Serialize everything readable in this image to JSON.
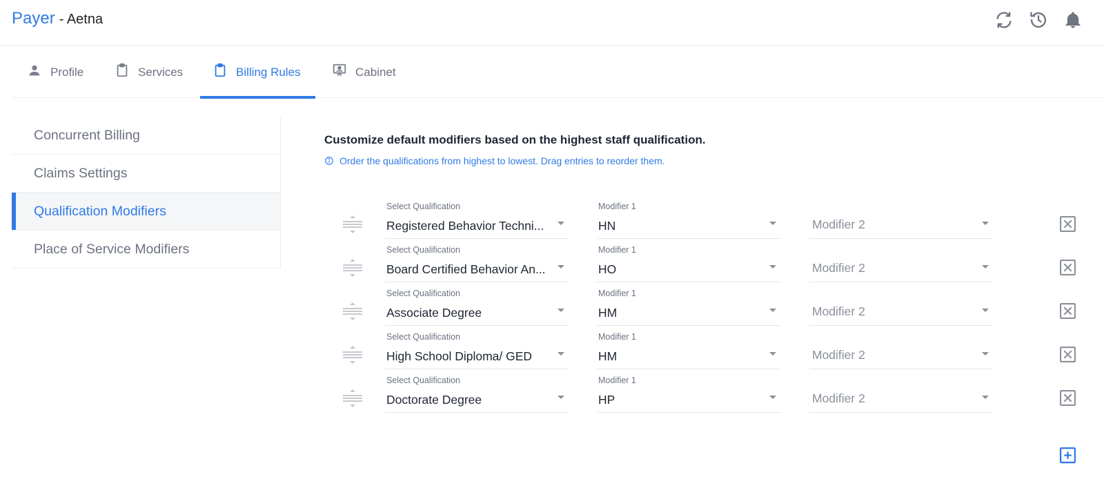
{
  "header": {
    "brand": "Payer",
    "subtitle": "- Aetna",
    "icons": [
      "sync-icon",
      "history-icon",
      "bell-icon"
    ]
  },
  "tabs": [
    {
      "label": "Profile",
      "icon": "person-icon",
      "active": false
    },
    {
      "label": "Services",
      "icon": "clipboard-icon",
      "active": false
    },
    {
      "label": "Billing Rules",
      "icon": "clipboard-icon",
      "active": true
    },
    {
      "label": "Cabinet",
      "icon": "presentation-icon",
      "active": false
    }
  ],
  "sidebar": {
    "items": [
      {
        "label": "Concurrent Billing",
        "active": false
      },
      {
        "label": "Claims Settings",
        "active": false
      },
      {
        "label": "Qualification Modifiers",
        "active": true
      },
      {
        "label": "Place of Service Modifiers",
        "active": false
      }
    ]
  },
  "main": {
    "title": "Customize default modifiers based on the highest staff qualification.",
    "note": "Order the qualifications from highest to lowest. Drag entries to reorder them.",
    "rows": [
      {
        "qual_label": "Select Qualification",
        "qualification": "Registered Behavior Techni...",
        "mod1_label": "Modifier 1",
        "modifier1": "HN",
        "modifier2_placeholder": "Modifier 2"
      },
      {
        "qual_label": "Select Qualification",
        "qualification": "Board Certified Behavior An...",
        "mod1_label": "Modifier 1",
        "modifier1": "HO",
        "modifier2_placeholder": "Modifier 2"
      },
      {
        "qual_label": "Select Qualification",
        "qualification": "Associate Degree",
        "mod1_label": "Modifier 1",
        "modifier1": "HM",
        "modifier2_placeholder": "Modifier 2"
      },
      {
        "qual_label": "Select Qualification",
        "qualification": "High School Diploma/ GED",
        "mod1_label": "Modifier 1",
        "modifier1": "HM",
        "modifier2_placeholder": "Modifier 2"
      },
      {
        "qual_label": "Select Qualification",
        "qualification": "Doctorate Degree",
        "mod1_label": "Modifier 1",
        "modifier1": "HP",
        "modifier2_placeholder": "Modifier 2"
      }
    ]
  },
  "colors": {
    "accent": "#2f7ae5",
    "text": "#1f2533",
    "muted": "#6b7280"
  }
}
